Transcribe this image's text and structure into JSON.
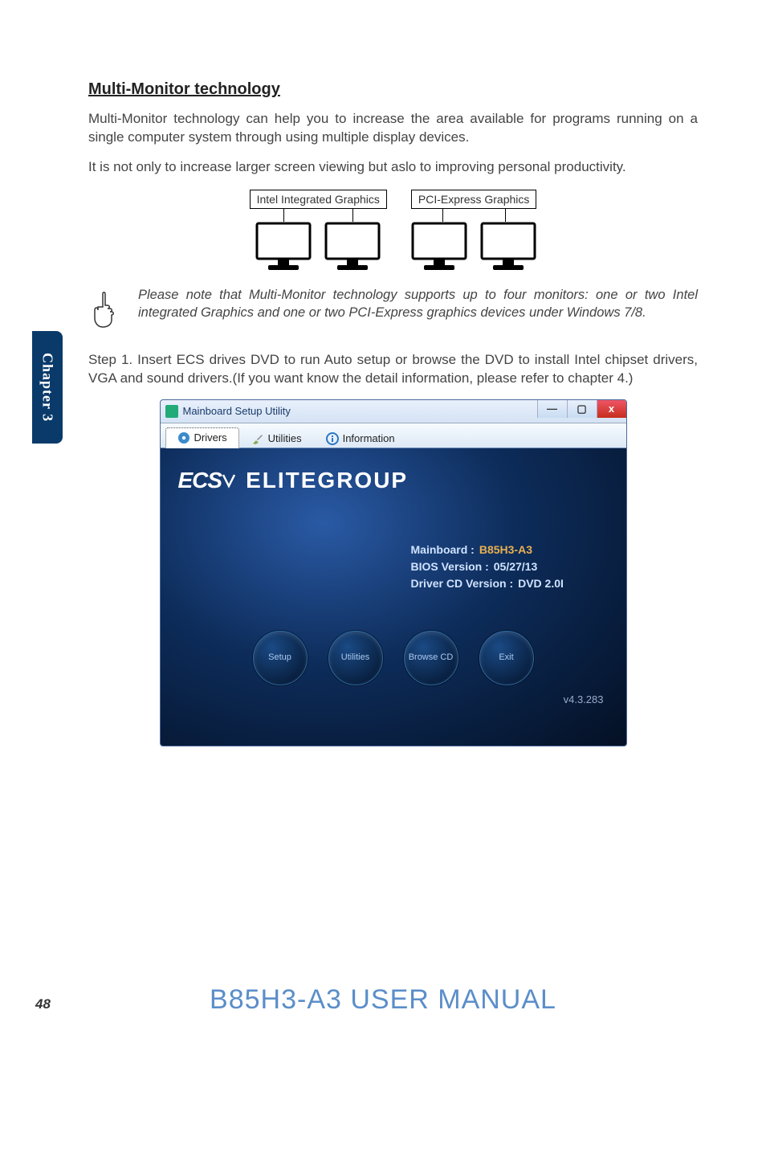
{
  "chapter_tab": "Chapter 3",
  "section_title": "Multi-Monitor technology",
  "para1": "Multi-Monitor technology can help you to increase the area available for programs running on a single computer system through using multiple display devices.",
  "para2": "It is not only to increase larger screen viewing but aslo to improving personal productivity.",
  "diagram": {
    "left_label": "Intel Integrated Graphics",
    "right_label": "PCI-Express Graphics"
  },
  "note_text": "Please note that Multi-Monitor technology supports up to four monitors: one or two Intel integrated Graphics and one or two PCI-Express graphics devices under Windows 7/8.",
  "step1": "Step 1. Insert ECS drives DVD to run Auto setup or browse the DVD to install Intel chipset drivers, VGA and sound drivers.(If you want know the detail information, please refer to chapter 4.)",
  "app": {
    "window_title": "Mainboard Setup Utility",
    "tabs": {
      "drivers": "Drivers",
      "utilities": "Utilities",
      "information": "Information"
    },
    "logo_small": "ECS",
    "logo_big": "ELITEGROUP",
    "info": {
      "mainboard_label": "Mainboard :",
      "mainboard_value": "B85H3-A3",
      "bios_label": "BIOS Version :",
      "bios_value": "05/27/13",
      "cd_label": "Driver CD Version :",
      "cd_value": "DVD 2.0I"
    },
    "buttons": {
      "setup": "Setup",
      "utilities": "Utilities",
      "browse": "Browse CD",
      "exit": "Exit"
    },
    "version": "v4.3.283"
  },
  "footer_title": "B85H3-A3 USER MANUAL",
  "page_number": "48"
}
